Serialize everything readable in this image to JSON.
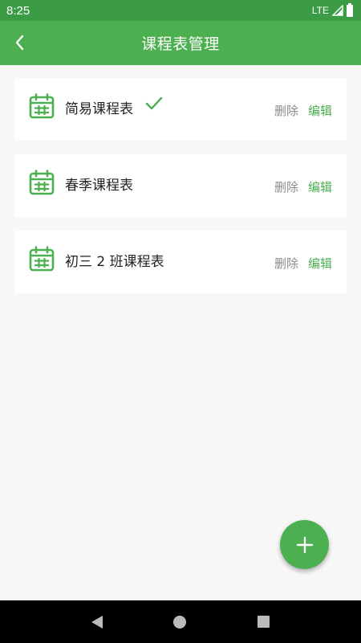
{
  "status_bar": {
    "time": "8:25",
    "network": "LTE"
  },
  "app_bar": {
    "title": "课程表管理"
  },
  "schedules": [
    {
      "name": "简易课程表",
      "selected": true,
      "delete_label": "删除",
      "edit_label": "编辑"
    },
    {
      "name": "春季课程表",
      "selected": false,
      "delete_label": "删除",
      "edit_label": "编辑"
    },
    {
      "name": "初三 2 班课程表",
      "selected": false,
      "delete_label": "删除",
      "edit_label": "编辑"
    }
  ],
  "icons": {
    "back": "chevron-left-icon",
    "calendar": "calendar-icon",
    "check": "check-icon",
    "add": "plus-icon"
  },
  "colors": {
    "primary": "#4caf50",
    "status_bar": "#3c9c46",
    "muted": "#8a8a8a"
  }
}
